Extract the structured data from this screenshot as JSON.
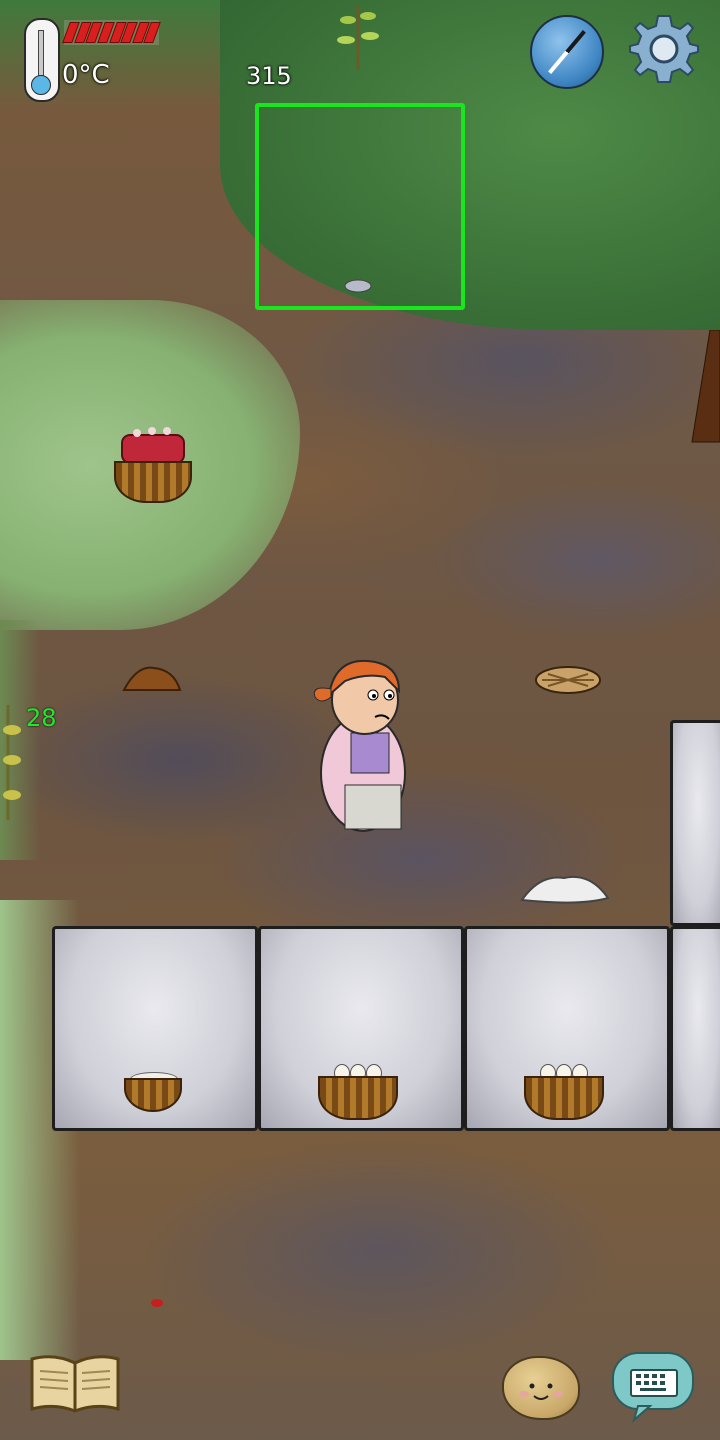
{
  "hud": {
    "temperature": "0°C",
    "food_pips_filled": 8,
    "food_pips_total": 8,
    "age": "315",
    "nearby_count": "28"
  },
  "icons": {
    "thermometer": "thermometer-icon",
    "compass": "compass-icon",
    "settings": "gear-icon",
    "book": "book-icon",
    "emote": "potato-face-icon",
    "chat": "keyboard-icon"
  },
  "colors": {
    "selector_border": "#19e61f",
    "food_pip": "#d91e1e",
    "count_text": "#1cea28"
  }
}
